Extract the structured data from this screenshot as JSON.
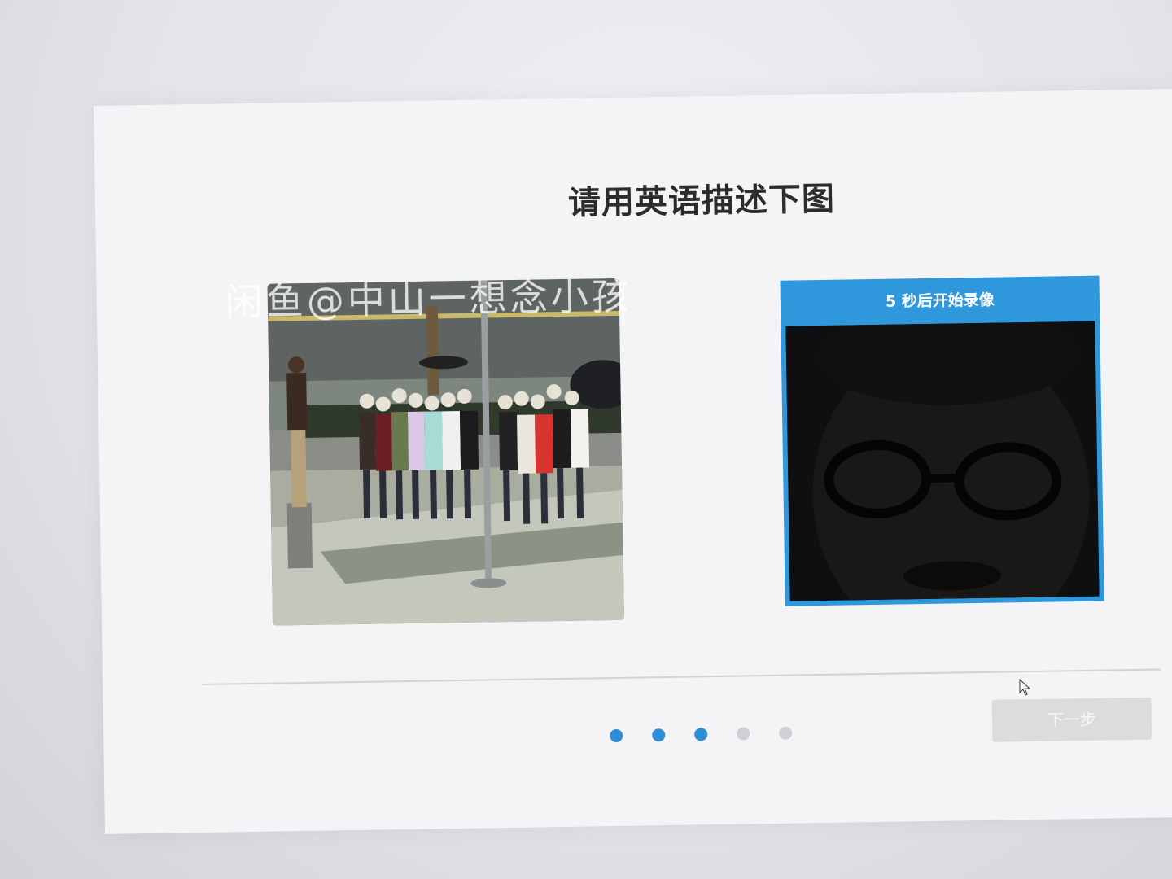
{
  "dialog": {
    "title": "请用英语描述下图",
    "watermark": "闲鱼@中山一想念小孩"
  },
  "camera": {
    "status_text": "5 秒后开始录像"
  },
  "pager": {
    "total_steps": 5,
    "completed_steps": 3
  },
  "footer": {
    "next_label": "下一步"
  },
  "colors": {
    "accent": "#2f97dc",
    "dot_active": "#2f8fd6",
    "dot_inactive": "#d0d0d4",
    "button_disabled": "#dcdcdf"
  }
}
